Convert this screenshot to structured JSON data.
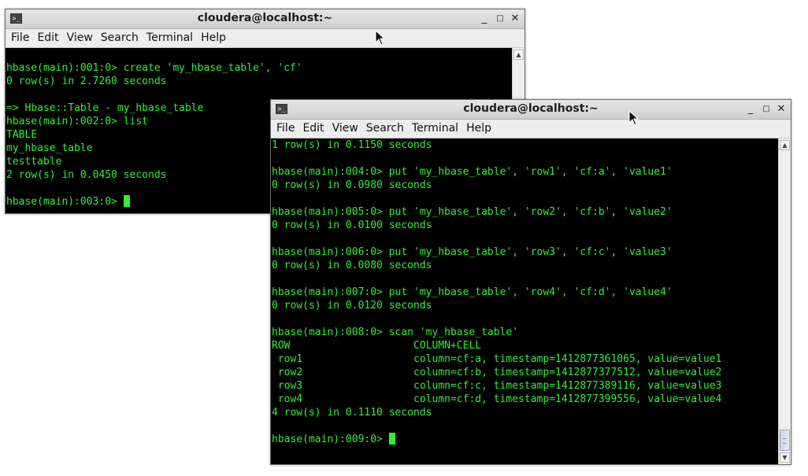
{
  "windows": [
    {
      "title": "cloudera@localhost:~",
      "menu": [
        "File",
        "Edit",
        "View",
        "Search",
        "Terminal",
        "Help"
      ],
      "lines": [
        "",
        "hbase(main):001:0> create 'my_hbase_table', 'cf'",
        "0 row(s) in 2.7260 seconds",
        "",
        "=> Hbase::Table - my_hbase_table",
        "hbase(main):002:0> list",
        "TABLE",
        "my_hbase_table",
        "testtable",
        "2 row(s) in 0.0450 seconds",
        "",
        "hbase(main):003:0> "
      ]
    },
    {
      "title": "cloudera@localhost:~",
      "menu": [
        "File",
        "Edit",
        "View",
        "Search",
        "Terminal",
        "Help"
      ],
      "lines": [
        "1 row(s) in 0.1150 seconds",
        "",
        "hbase(main):004:0> put 'my_hbase_table', 'row1', 'cf:a', 'value1'",
        "0 row(s) in 0.0980 seconds",
        "",
        "hbase(main):005:0> put 'my_hbase_table', 'row2', 'cf:b', 'value2'",
        "0 row(s) in 0.0100 seconds",
        "",
        "hbase(main):006:0> put 'my_hbase_table', 'row3', 'cf:c', 'value3'",
        "0 row(s) in 0.0080 seconds",
        "",
        "hbase(main):007:0> put 'my_hbase_table', 'row4', 'cf:d', 'value4'",
        "0 row(s) in 0.0120 seconds",
        "",
        "hbase(main):008:0> scan 'my_hbase_table'",
        "ROW                    COLUMN+CELL",
        " row1                  column=cf:a, timestamp=1412877361065, value=value1",
        " row2                  column=cf:b, timestamp=1412877377512, value=value2",
        " row3                  column=cf:c, timestamp=1412877389116, value=value3",
        " row4                  column=cf:d, timestamp=1412877399556, value=value4",
        "4 row(s) in 0.1110 seconds",
        "",
        "hbase(main):009:0> "
      ]
    }
  ],
  "colors": {
    "terminal_bg": "#000000",
    "terminal_fg": "#30f030"
  },
  "icons": {
    "window_controls": [
      "minimize-icon",
      "maximize-icon",
      "close-icon"
    ],
    "titlebar": "terminal-icon",
    "pointer": "mouse-pointer-icon"
  }
}
